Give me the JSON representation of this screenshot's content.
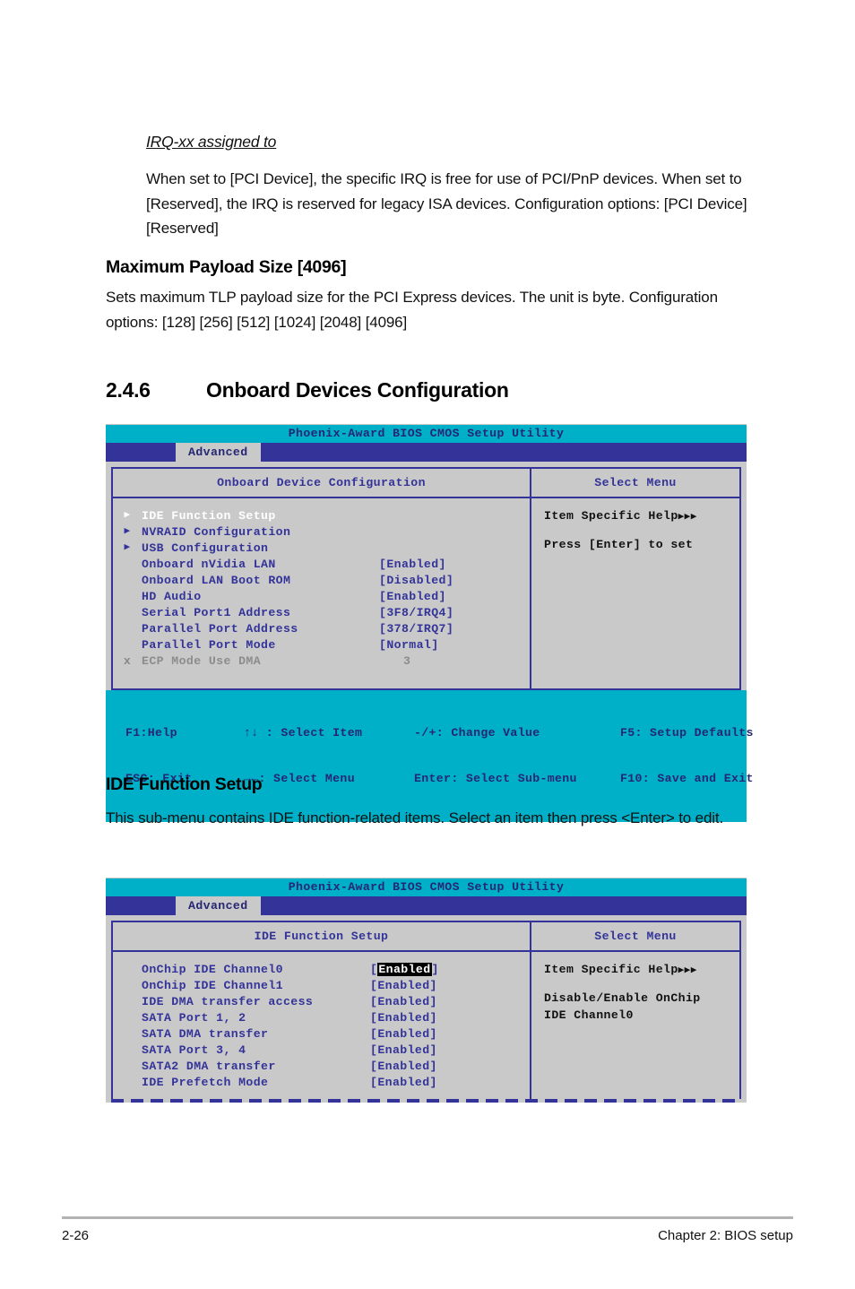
{
  "doc": {
    "irq_heading": "IRQ-xx assigned to",
    "irq_body": "When set to [PCI Device], the specific IRQ is free for use of PCI/PnP devices. When set to [Reserved], the IRQ is reserved for legacy ISA devices. Configuration options: [PCI Device] [Reserved]",
    "payload_heading": "Maximum Payload Size [4096]",
    "payload_body": "Sets maximum TLP payload size for the PCI Express devices. The unit is byte. Configuration options: [128] [256] [512] [1024] [2048] [4096]",
    "section_number": "2.4.6",
    "section_title": "Onboard Devices Configuration",
    "ide_heading": "IDE Function Setup",
    "ide_body": "This sub-menu contains IDE function-related items. Select an item then press <Enter> to edit."
  },
  "footer": {
    "page_number": "2-26",
    "chapter": "Chapter 2: BIOS setup"
  },
  "colors": {
    "title_bar": "#00b0c8",
    "tab_bar": "#333399",
    "panel_bg": "#c9c9c9",
    "text_blue": "#333399",
    "highlight_bg": "#000000"
  },
  "bios1": {
    "title": "Phoenix-Award BIOS CMOS Setup Utility",
    "tab": "Advanced",
    "panel_title": "Onboard Device Configuration",
    "side_title": "Select Menu",
    "help_label": "Item Specific Help",
    "help_arrows": "▶▶▶",
    "help_lines": [
      "Press [Enter] to set"
    ],
    "items": [
      {
        "arrow": "▶",
        "label": "IDE Function Setup",
        "value": "",
        "state": "selected"
      },
      {
        "arrow": "▶",
        "label": "NVRAID Configuration",
        "value": "",
        "state": "normal"
      },
      {
        "arrow": "▶",
        "label": "USB Configuration",
        "value": "",
        "state": "normal"
      },
      {
        "arrow": "",
        "label": "Onboard nVidia LAN",
        "value": "[Enabled]",
        "state": "normal"
      },
      {
        "arrow": "",
        "label": "Onboard LAN Boot ROM",
        "value": "[Disabled]",
        "state": "normal"
      },
      {
        "arrow": "",
        "label": "HD Audio",
        "value": "[Enabled]",
        "state": "normal"
      },
      {
        "arrow": "",
        "label": "Serial Port1 Address",
        "value": "[3F8/IRQ4]",
        "state": "normal"
      },
      {
        "arrow": "",
        "label": "Parallel Port Address",
        "value": "[378/IRQ7]",
        "state": "normal"
      },
      {
        "arrow": "",
        "label": "Parallel Port Mode",
        "value": "[Normal]",
        "state": "normal"
      },
      {
        "arrow": "x",
        "label": "ECP Mode Use DMA",
        "value": "3",
        "state": "disabled"
      }
    ],
    "legend": [
      [
        "F1:Help",
        "↑↓ : Select Item",
        "-/+: Change Value",
        "F5: Setup Defaults"
      ],
      [
        "ESC: Exit",
        "→←: Select Menu",
        "Enter: Select Sub-menu",
        "F10: Save and Exit"
      ]
    ]
  },
  "bios2": {
    "title": "Phoenix-Award BIOS CMOS Setup Utility",
    "tab": "Advanced",
    "panel_title": "IDE Function Setup",
    "side_title": "Select Menu",
    "help_label": "Item Specific Help",
    "help_arrows": "▶▶▶",
    "help_lines": [
      "Disable/Enable OnChip",
      "IDE Channel0"
    ],
    "items": [
      {
        "label": "OnChip IDE Channel0",
        "value": "Enabled",
        "highlighted": true
      },
      {
        "label": "OnChip IDE Channel1",
        "value": "Enabled",
        "highlighted": false
      },
      {
        "label": "IDE DMA transfer access",
        "value": "Enabled",
        "highlighted": false
      },
      {
        "label": "SATA Port 1, 2",
        "value": "Enabled",
        "highlighted": false
      },
      {
        "label": "SATA DMA transfer",
        "value": "Enabled",
        "highlighted": false
      },
      {
        "label": "SATA Port 3, 4",
        "value": "Enabled",
        "highlighted": false
      },
      {
        "label": "SATA2 DMA transfer",
        "value": "Enabled",
        "highlighted": false
      },
      {
        "label": "IDE Prefetch Mode",
        "value": "Enabled",
        "highlighted": false
      }
    ]
  }
}
